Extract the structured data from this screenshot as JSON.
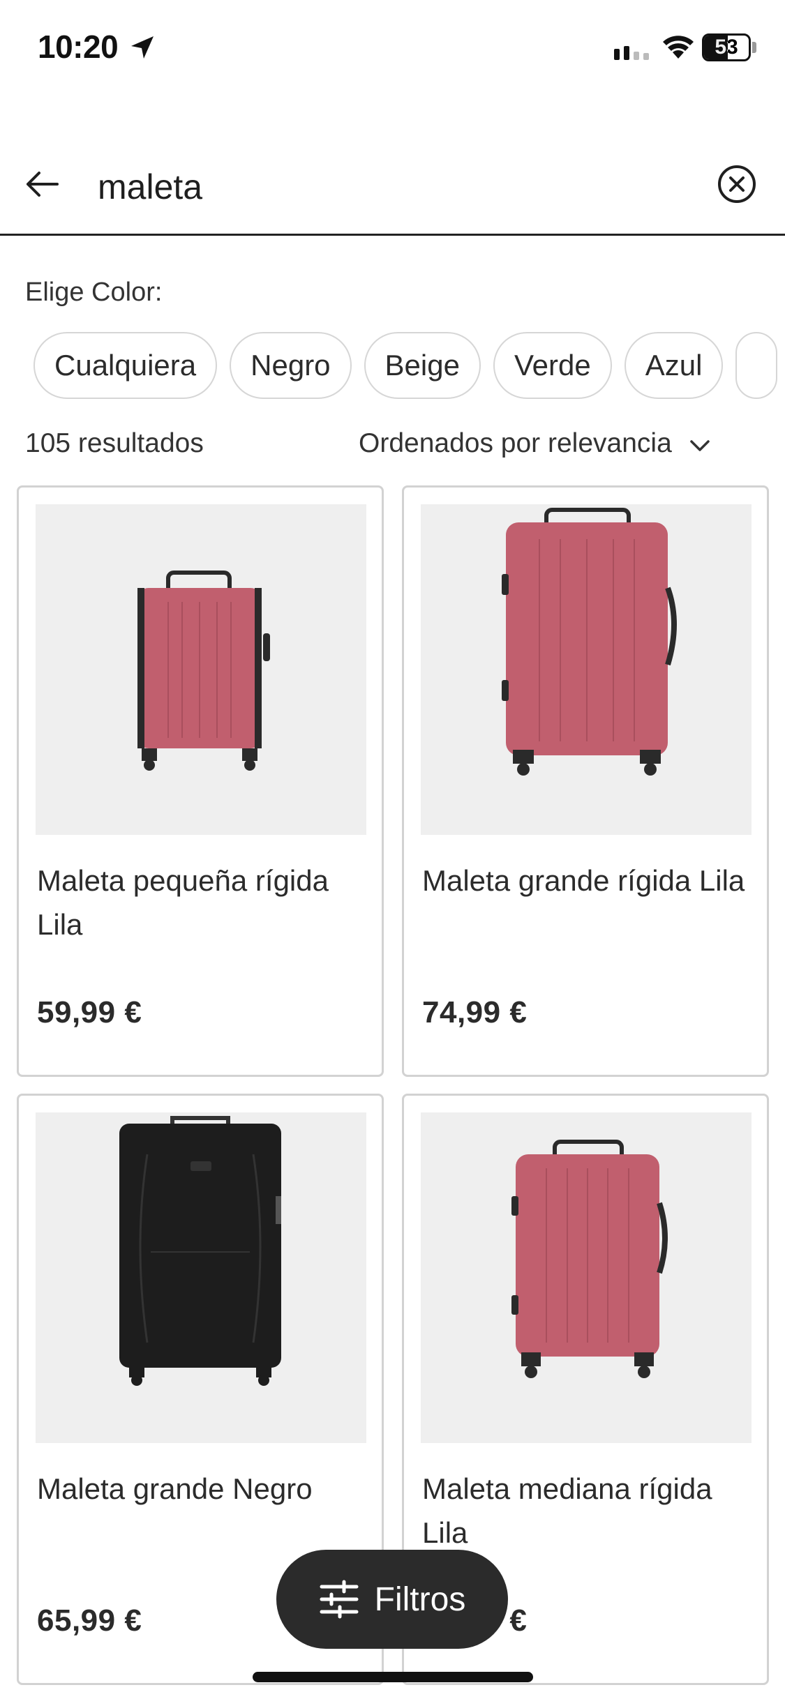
{
  "status_bar": {
    "time": "10:20",
    "battery": "53",
    "battery_level": 0.53,
    "icons": [
      "location-arrow-icon",
      "signal-icon",
      "wifi-icon",
      "battery-icon"
    ]
  },
  "search": {
    "query": "maleta",
    "icons": [
      "back-arrow-icon",
      "clear-search-icon"
    ]
  },
  "filters": {
    "color_label": "Elige Color:",
    "chips": [
      "Cualquiera",
      "Negro",
      "Beige",
      "Verde",
      "Azul",
      ""
    ]
  },
  "results": {
    "count": "105 resultados",
    "sort": "Ordenados por relevancia",
    "sort_icon": "chevron-down-icon"
  },
  "products": [
    {
      "name": "Maleta pequeña rígida Lila",
      "price": "59,99 €",
      "color": "#c15f6e",
      "image": "small-pink-suitcase"
    },
    {
      "name": "Maleta grande rígida Lila",
      "price": "74,99 €",
      "color": "#c15f6e",
      "image": "large-pink-suitcase"
    },
    {
      "name": "Maleta grande Negro",
      "price": "65,99 €",
      "color": "#1f1f1f",
      "image": "large-black-soft-suitcase"
    },
    {
      "name": "Maleta mediana rígida Lila",
      "price": "69,99 €",
      "color": "#c15f6e",
      "image": "medium-pink-suitcase"
    }
  ],
  "filter_button": {
    "label": "Filtros",
    "icon": "sliders-icon"
  },
  "colors": {
    "dark_button": "#2b2b2b",
    "card_border": "#d2d2d2",
    "image_bg": "#efefef",
    "suitcase_pink": "#c15f6e"
  }
}
